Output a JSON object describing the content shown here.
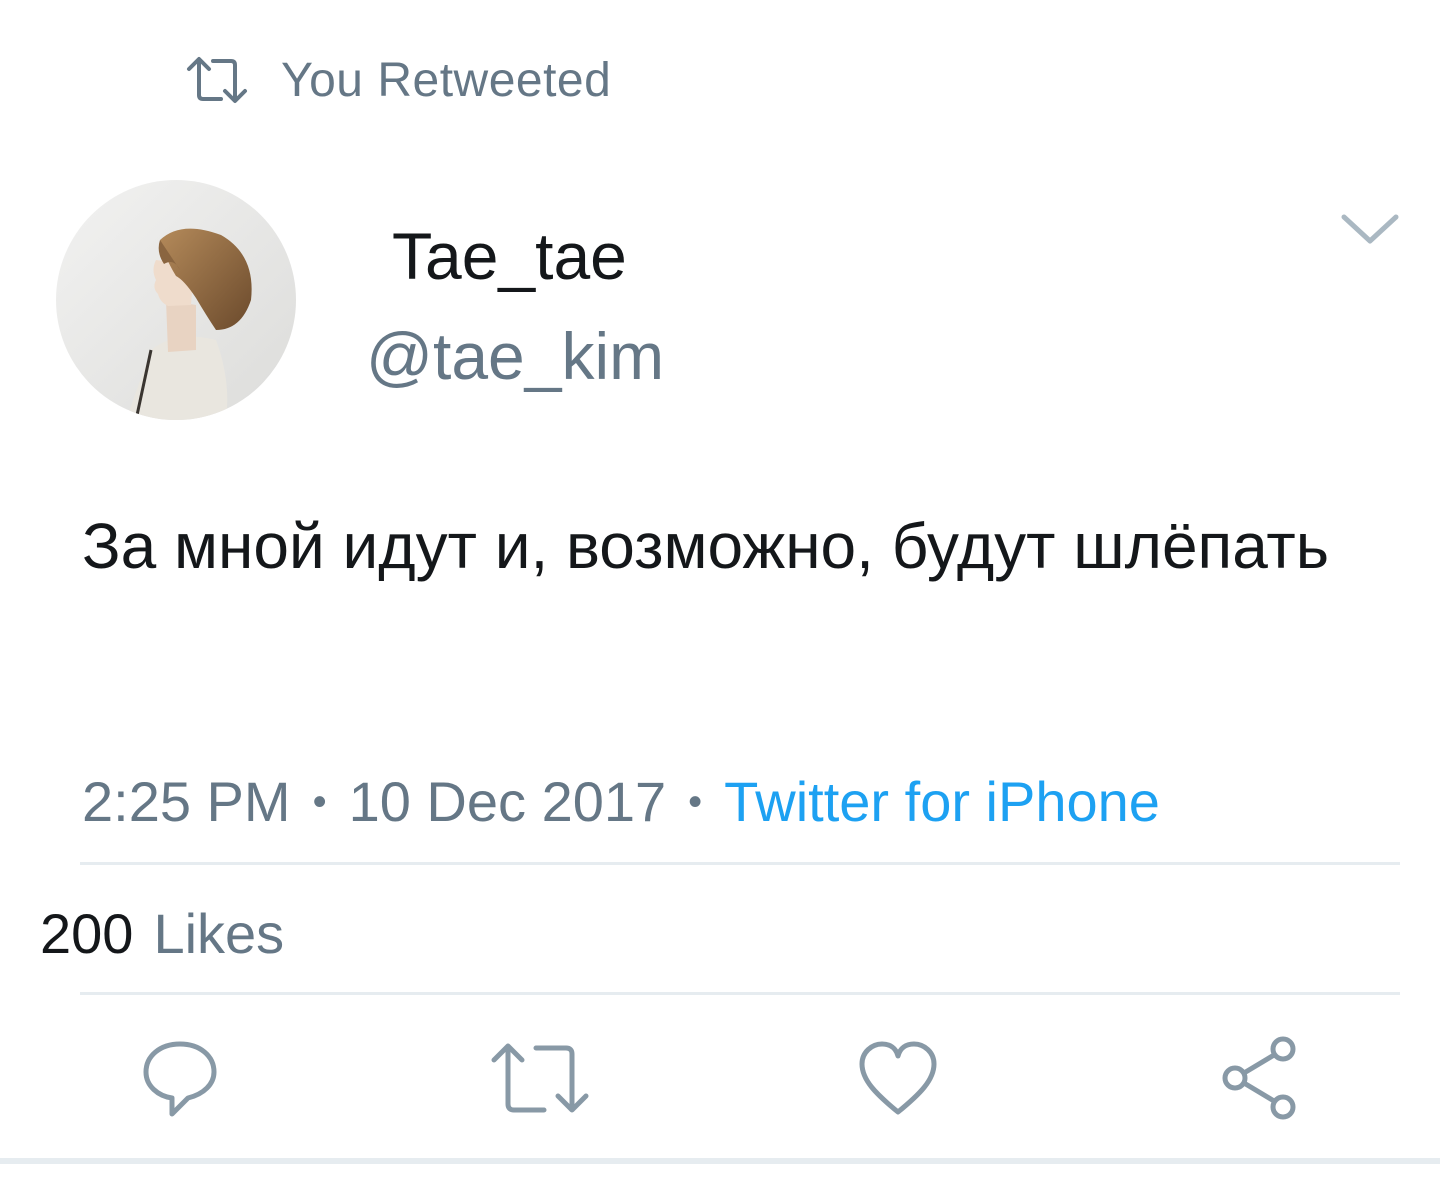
{
  "retweet_banner": {
    "icon": "retweet-icon",
    "label": "You Retweeted"
  },
  "author": {
    "display_name": "Tae_tae",
    "handle": "@tae_kim",
    "avatar": "profile-photo"
  },
  "tweet": {
    "text": "За мной идут и, возможно, будут шлёпать"
  },
  "meta": {
    "time": "2:25 PM",
    "separator": "•",
    "date": "10 Dec 2017",
    "source": "Twitter for iPhone"
  },
  "stats": {
    "likes_count": "200",
    "likes_label": "Likes"
  },
  "actions": [
    {
      "name": "reply",
      "icon": "reply-icon"
    },
    {
      "name": "retweet",
      "icon": "retweet-icon"
    },
    {
      "name": "like",
      "icon": "heart-icon"
    },
    {
      "name": "share",
      "icon": "share-icon"
    }
  ],
  "colors": {
    "text_primary": "#14171a",
    "text_secondary": "#657786",
    "link": "#1da1f2",
    "divider": "#e6ecf0"
  }
}
